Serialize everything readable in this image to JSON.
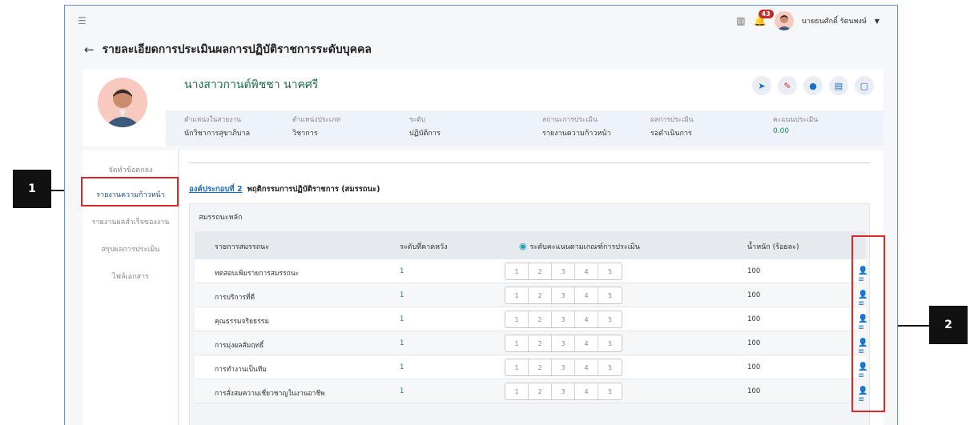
{
  "topbar": {
    "menu_icon": "menu-collapse-icon",
    "notification_count": "43",
    "username": "นายธนศักดิ์ รัตนพงษ์",
    "caret": "▼"
  },
  "page": {
    "title": "รายละเอียดการประเมินผลการปฏิบัติราชการระดับบุคคล"
  },
  "profile": {
    "name": "นางสาวกานต์พิชชา นาคศรี",
    "fields": [
      {
        "label": "ตำแหน่งในสายงาน",
        "value": "นักวิชาการสุขาภิบาล"
      },
      {
        "label": "ตำแหน่งประเภท",
        "value": "วิชาการ"
      },
      {
        "label": "ระดับ",
        "value": "ปฏิบัติการ"
      },
      {
        "label": "สถานะการประเมิน",
        "value": "รายงานความก้าวหน้า"
      },
      {
        "label": "ผลการประเมิน",
        "value": "รอดำเนินการ"
      },
      {
        "label": "คะแนนประเมิน",
        "value": "0.00"
      }
    ]
  },
  "nav": {
    "items": [
      {
        "label": "จัดทำข้อตกลง"
      },
      {
        "label": "รายงานความก้าวหน้า"
      },
      {
        "label": "รายงานผลสำเร็จของงาน"
      },
      {
        "label": "สรุปผลการประเมิน"
      },
      {
        "label": "ไฟล์เอกสาร"
      }
    ]
  },
  "section": {
    "link": "องค์ประกอบที่ 2",
    "title": "พฤติกรรมการปฏิบัติราชการ (สมรรถนะ)",
    "group": "สมรรถนะหลัก"
  },
  "table": {
    "headers": {
      "name": "รายการสมรรถนะ",
      "expected": "ระดับที่คาดหวัง",
      "score": "ระดับคะแนนตามเกณฑ์การประเมิน",
      "weight": "น้ำหนัก (ร้อยละ)"
    },
    "scale": [
      "1",
      "2",
      "3",
      "4",
      "5"
    ],
    "rows": [
      {
        "name": "ทดสอบเพิ่มรายการสมรรถนะ",
        "expected": "1",
        "weight": "100"
      },
      {
        "name": "การบริการที่ดี",
        "expected": "1",
        "weight": "100"
      },
      {
        "name": "คุณธรรมจริยธรรม",
        "expected": "1",
        "weight": "100"
      },
      {
        "name": "การมุ่งผลสัมฤทธิ์",
        "expected": "1",
        "weight": "100"
      },
      {
        "name": "การทำงานเป็นทีม",
        "expected": "1",
        "weight": "100"
      },
      {
        "name": "การสั่งสมความเชี่ยวชาญในงานอาชีพ",
        "expected": "1",
        "weight": "100"
      }
    ]
  },
  "callouts": [
    "1",
    "2"
  ],
  "colors": {
    "accent": "#1a6fc4",
    "green": "#1b8a56",
    "highlight": "#e32626"
  }
}
